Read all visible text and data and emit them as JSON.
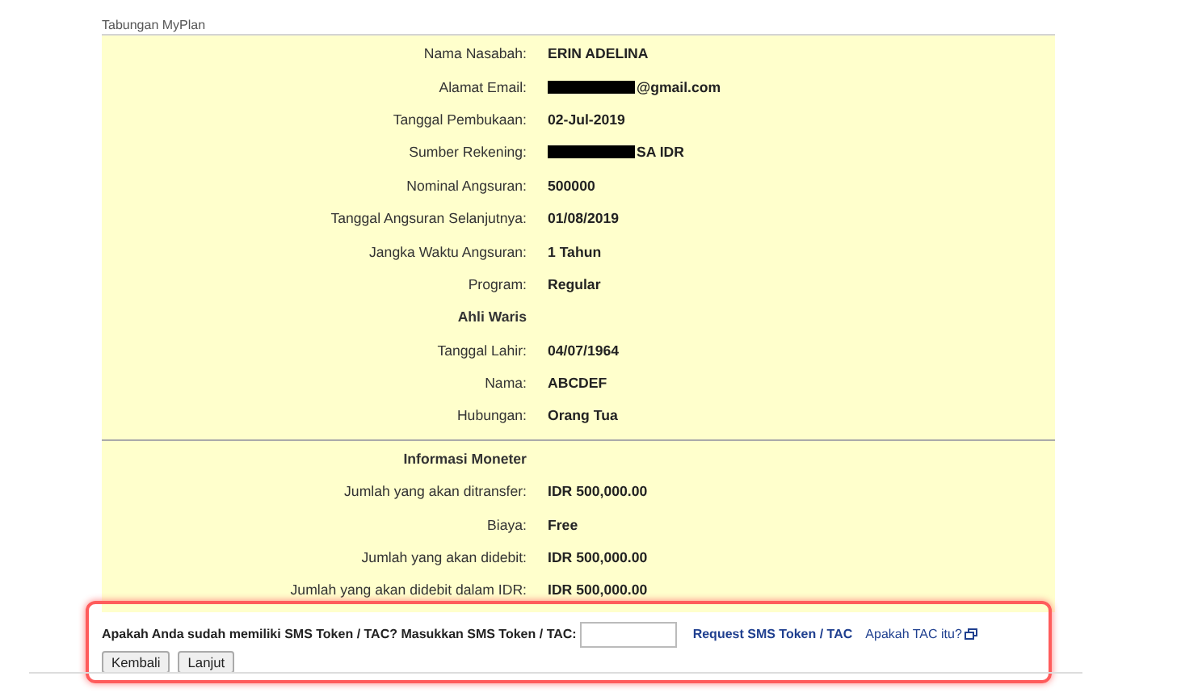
{
  "section_title": "Tabungan MyPlan",
  "sections": [
    {
      "rows": [
        {
          "kind": "field",
          "label": "Nama Nasabah:",
          "value": "ERIN ADELINA",
          "redacted": false
        },
        {
          "kind": "field",
          "label": "Alamat Email:",
          "value": "@gmail.com",
          "redacted": true
        },
        {
          "kind": "field",
          "label": "Tanggal Pembukaan:",
          "value": "02-Jul-2019",
          "redacted": false
        },
        {
          "kind": "field",
          "label": "Sumber Rekening:",
          "value": "SA IDR",
          "redacted": true
        },
        {
          "kind": "field",
          "label": "Nominal Angsuran:",
          "value": "500000",
          "redacted": false
        },
        {
          "kind": "field",
          "label": "Tanggal Angsuran Selanjutnya:",
          "value": "01/08/2019",
          "redacted": false
        },
        {
          "kind": "field",
          "label": "Jangka Waktu Angsuran:",
          "value": "1 Tahun",
          "redacted": false
        },
        {
          "kind": "field",
          "label": "Program:",
          "value": "Regular",
          "redacted": false
        },
        {
          "kind": "heading",
          "label": "Ahli Waris"
        },
        {
          "kind": "field",
          "label": "Tanggal Lahir:",
          "value": "04/07/1964",
          "redacted": false
        },
        {
          "kind": "field",
          "label": "Nama:",
          "value": "ABCDEF",
          "redacted": false
        },
        {
          "kind": "field",
          "label": "Hubungan:",
          "value": "Orang Tua",
          "redacted": false
        }
      ]
    },
    {
      "rows": [
        {
          "kind": "heading",
          "label": "Informasi Moneter"
        },
        {
          "kind": "field",
          "label": "Jumlah yang akan ditransfer:",
          "value": "IDR 500,000.00",
          "redacted": false
        },
        {
          "kind": "field",
          "label": "Biaya:",
          "value": "Free",
          "redacted": false
        },
        {
          "kind": "field",
          "label": "Jumlah yang akan didebit:",
          "value": "IDR 500,000.00",
          "redacted": false
        },
        {
          "kind": "field",
          "label": "Jumlah yang akan didebit dalam IDR:",
          "value": "IDR 500,000.00",
          "redacted": false
        }
      ]
    }
  ],
  "tac": {
    "prompt": "Apakah Anda sudah memiliki SMS Token / TAC? Masukkan SMS Token / TAC:",
    "request_link": "Request SMS Token / TAC",
    "help_link": "Apakah TAC itu?"
  },
  "buttons": [
    "Kembali",
    "Lanjut"
  ]
}
